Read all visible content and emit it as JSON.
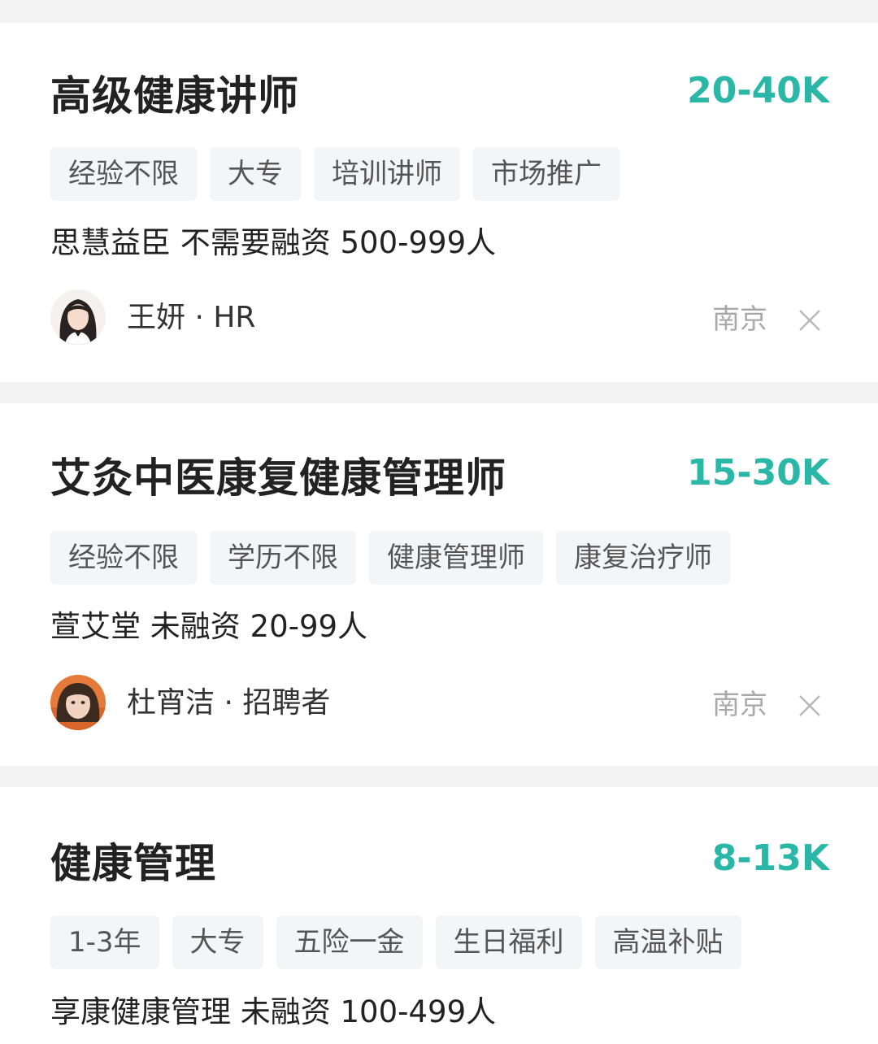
{
  "jobs": [
    {
      "title": "高级健康讲师",
      "salary": "20-40K",
      "tags": [
        "经验不限",
        "大专",
        "培训讲师",
        "市场推广"
      ],
      "company": "思慧益臣 不需要融资 500-999人",
      "recruiter": "王妍 · HR",
      "city": "南京"
    },
    {
      "title": "艾灸中医康复健康管理师",
      "salary": "15-30K",
      "tags": [
        "经验不限",
        "学历不限",
        "健康管理师",
        "康复治疗师"
      ],
      "company": "萱艾堂 未融资 20-99人",
      "recruiter": "杜宵洁 · 招聘者",
      "city": "南京"
    },
    {
      "title": "健康管理",
      "salary": "8-13K",
      "tags": [
        "1-3年",
        "大专",
        "五险一金",
        "生日福利",
        "高温补贴"
      ],
      "company": "享康健康管理 未融资 100-499人"
    }
  ]
}
